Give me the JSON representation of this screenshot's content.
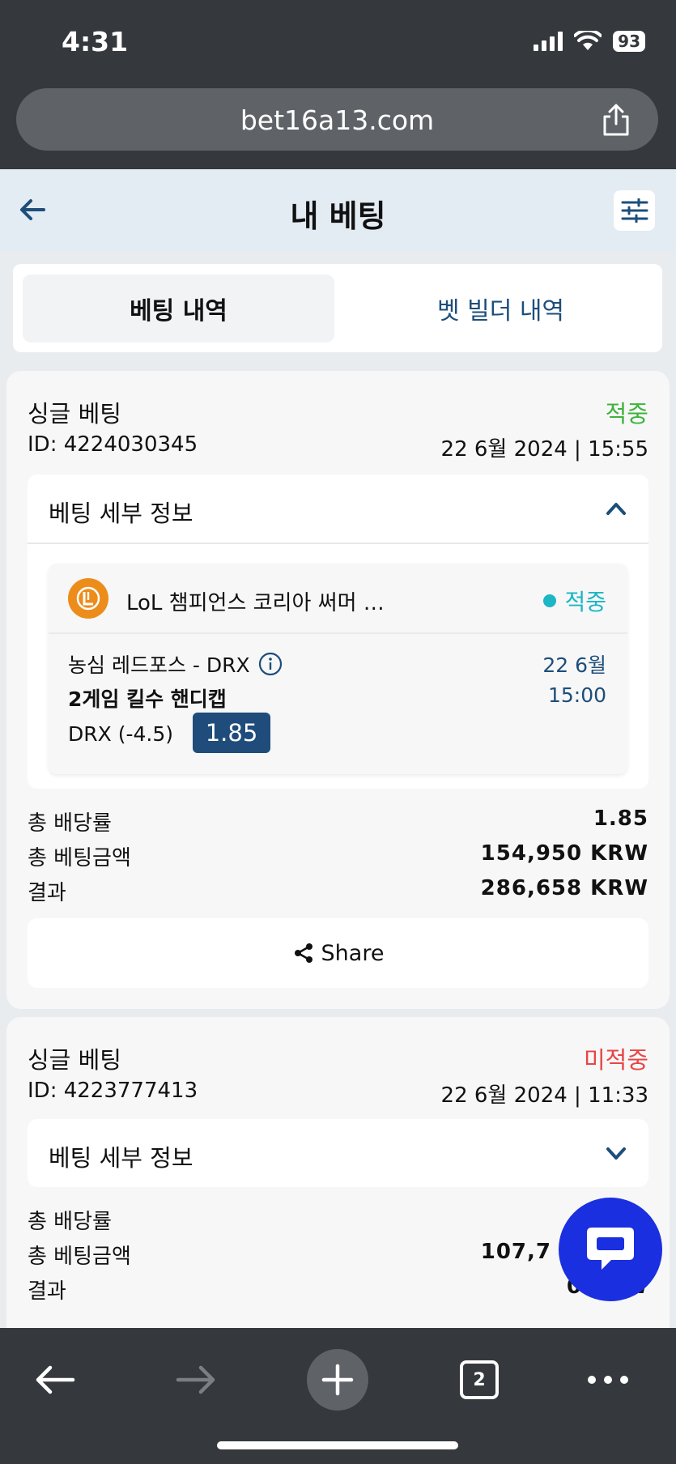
{
  "status_bar": {
    "time": "4:31",
    "battery": "93"
  },
  "browser": {
    "url": "bet16a13.com",
    "tab_count": "2"
  },
  "header": {
    "title": "내 베팅"
  },
  "tabs": [
    {
      "label": "베팅 내역",
      "active": true
    },
    {
      "label": "벳 빌더 내역",
      "active": false
    }
  ],
  "bets": [
    {
      "type": "싱글 베팅",
      "status": "적중",
      "id": "ID: 4224030345",
      "date": "22 6월 2024 | 15:55",
      "details_label": "베팅 세부 정보",
      "selection": {
        "league": "LoL 챔피언스 코리아 써머 …",
        "status": "적중",
        "match": "농심 레드포스 - DRX",
        "match_date": "22 6월",
        "market": "2게임 킬수 핸디캡",
        "match_time": "15:00",
        "pick": "DRX (-4.5)",
        "odds": "1.85"
      },
      "summary": [
        {
          "label": "총 배당률",
          "value": "1.85"
        },
        {
          "label": "총 베팅금액",
          "value": "154,950 KRW"
        },
        {
          "label": "결과",
          "value": "286,658 KRW"
        }
      ],
      "share_label": "Share"
    },
    {
      "type": "싱글 베팅",
      "status": "미적중",
      "id": "ID: 4223777413",
      "date": "22 6월 2024 | 11:33",
      "details_label": "베팅 세부 정보",
      "summary": [
        {
          "label": "총 배당률",
          "value": ""
        },
        {
          "label": "총 베팅금액",
          "value": "107,7"
        },
        {
          "label": "결과",
          "value": "0 KRW"
        }
      ]
    }
  ],
  "colors": {
    "won": "#3fb33d",
    "lost": "#e84545",
    "accent": "#1f4c7a",
    "chat": "#1a2fe0"
  }
}
